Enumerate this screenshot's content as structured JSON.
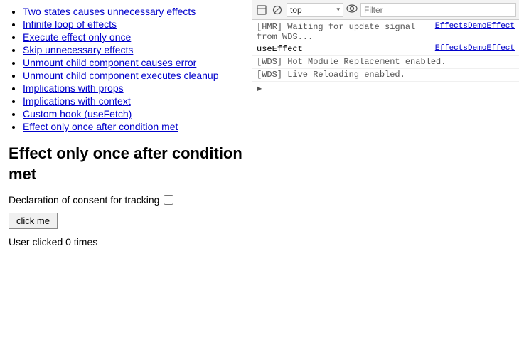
{
  "left": {
    "nav_items": [
      {
        "label": "Two states causes unnecessary effects",
        "href": "#"
      },
      {
        "label": "Infinite loop of effects",
        "href": "#"
      },
      {
        "label": "Execute effect only once",
        "href": "#"
      },
      {
        "label": "Skip unnecessary effects",
        "href": "#"
      },
      {
        "label": "Unmount child component causes error",
        "href": "#"
      },
      {
        "label": "Unmount child component executes cleanup",
        "href": "#"
      },
      {
        "label": "Implications with props",
        "href": "#"
      },
      {
        "label": "Implications with context",
        "href": "#"
      },
      {
        "label": "Custom hook (useFetch)",
        "href": "#"
      },
      {
        "label": "Effect only once after condition met",
        "href": "#"
      }
    ],
    "section_title": "Effect only once after condition met",
    "declaration_label": "Declaration of consent for tracking",
    "click_button": "click me",
    "user_clicked_text": "User clicked 0 times"
  },
  "devtools": {
    "toolbar": {
      "top_label": "top",
      "filter_placeholder": "Filter"
    },
    "console_lines": [
      {
        "type": "hmr",
        "text": "[HMR] Waiting for update signal from WDS...",
        "source": "EffectsDemoEffect"
      },
      {
        "type": "use-effect",
        "label": "useEffect",
        "text": "useEffect",
        "source": "EffectsDemoEffect"
      },
      {
        "type": "wds",
        "text": "[WDS] Hot Module Replacement enabled."
      },
      {
        "type": "wds",
        "text": "[WDS] Live Reloading enabled."
      }
    ],
    "icons": {
      "cursor": "⊡",
      "block": "⊘",
      "eye": "👁"
    }
  }
}
